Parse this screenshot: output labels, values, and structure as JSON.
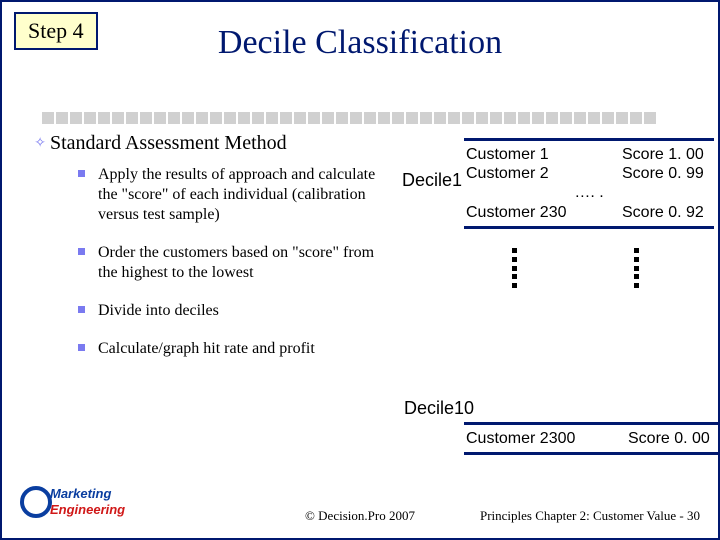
{
  "step_label": "Step 4",
  "title": "Decile Classification",
  "heading": "Standard Assessment Method",
  "bullets": [
    "Apply the results of approach and calculate the \"score\" of each individual (calibration versus test sample)",
    "Order the customers based on \"score\" from the highest to the lowest",
    "Divide into deciles",
    "Calculate/graph  hit rate and profit"
  ],
  "diagram": {
    "decile1_label": "Decile1",
    "rows": [
      {
        "c1": "Customer 1",
        "c2": "Score 1. 00"
      },
      {
        "c1": "Customer 2",
        "c2": "Score 0. 99"
      },
      {
        "c1": "…. .",
        "c2": ""
      },
      {
        "c1": "Customer 230",
        "c2": "Score 0. 92"
      }
    ],
    "decile10_label": "Decile10",
    "decile10_row": {
      "c1": "Customer 2300",
      "c2": "Score 0. 00"
    }
  },
  "logo": {
    "line1": "Marketing",
    "line2": "Engineering"
  },
  "copyright": "©  Decision.Pro 2007",
  "footer_right": "Principles Chapter 2: Customer Value - 30"
}
